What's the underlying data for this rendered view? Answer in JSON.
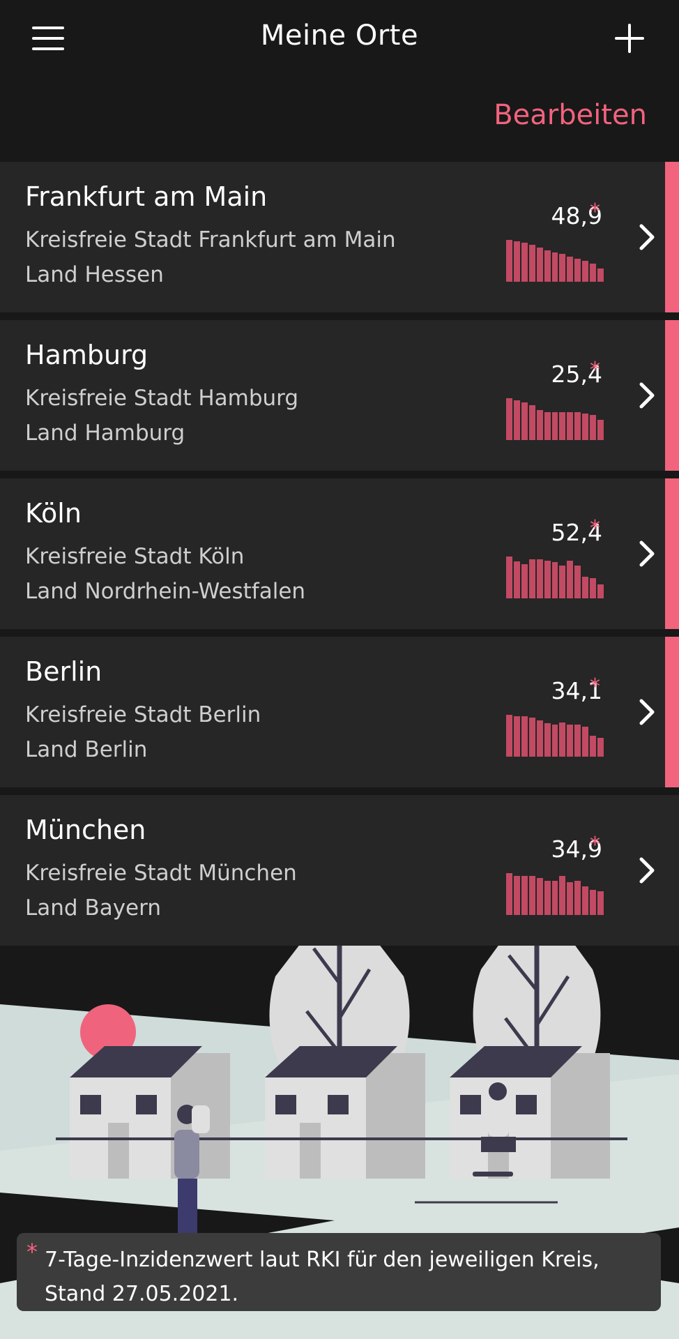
{
  "header": {
    "title": "Meine Orte",
    "edit_label": "Bearbeiten"
  },
  "accent_color": "#f2637d",
  "locations": [
    {
      "name": "Frankfurt am Main",
      "district": "Kreisfreie Stadt Frankfurt am Main",
      "state": "Land Hessen",
      "incidence": "48,9",
      "marker": "*",
      "trend": [
        1.0,
        0.97,
        0.93,
        0.88,
        0.82,
        0.75,
        0.7,
        0.66,
        0.6,
        0.55,
        0.5,
        0.44,
        0.32
      ]
    },
    {
      "name": "Hamburg",
      "district": "Kreisfreie Stadt Hamburg",
      "state": "Land Hamburg",
      "incidence": "25,4",
      "marker": "*",
      "trend": [
        1.0,
        0.95,
        0.9,
        0.83,
        0.72,
        0.66,
        0.66,
        0.66,
        0.66,
        0.66,
        0.64,
        0.6,
        0.48
      ]
    },
    {
      "name": "Köln",
      "district": "Kreisfreie Stadt Köln",
      "state": "Land Nordrhein-Westfalen",
      "incidence": "52,4",
      "marker": "*",
      "trend": [
        1.0,
        0.88,
        0.82,
        0.93,
        0.93,
        0.9,
        0.86,
        0.78,
        0.9,
        0.78,
        0.52,
        0.48,
        0.34
      ]
    },
    {
      "name": "Berlin",
      "district": "Kreisfreie Stadt Berlin",
      "state": "Land Berlin",
      "incidence": "34,1",
      "marker": "*",
      "trend": [
        1.0,
        0.97,
        0.97,
        0.93,
        0.87,
        0.8,
        0.76,
        0.82,
        0.76,
        0.76,
        0.72,
        0.5,
        0.45
      ]
    },
    {
      "name": "München",
      "district": "Kreisfreie Stadt München",
      "state": "Land Bayern",
      "incidence": "34,9",
      "marker": "*",
      "trend": [
        1.0,
        0.93,
        0.93,
        0.93,
        0.89,
        0.82,
        0.82,
        0.93,
        0.78,
        0.82,
        0.68,
        0.6,
        0.56
      ]
    }
  ],
  "footnote": {
    "marker": "*",
    "text": "7-Tage-Inzidenzwert laut RKI für den jeweiligen Kreis, Stand 27.05.2021."
  }
}
